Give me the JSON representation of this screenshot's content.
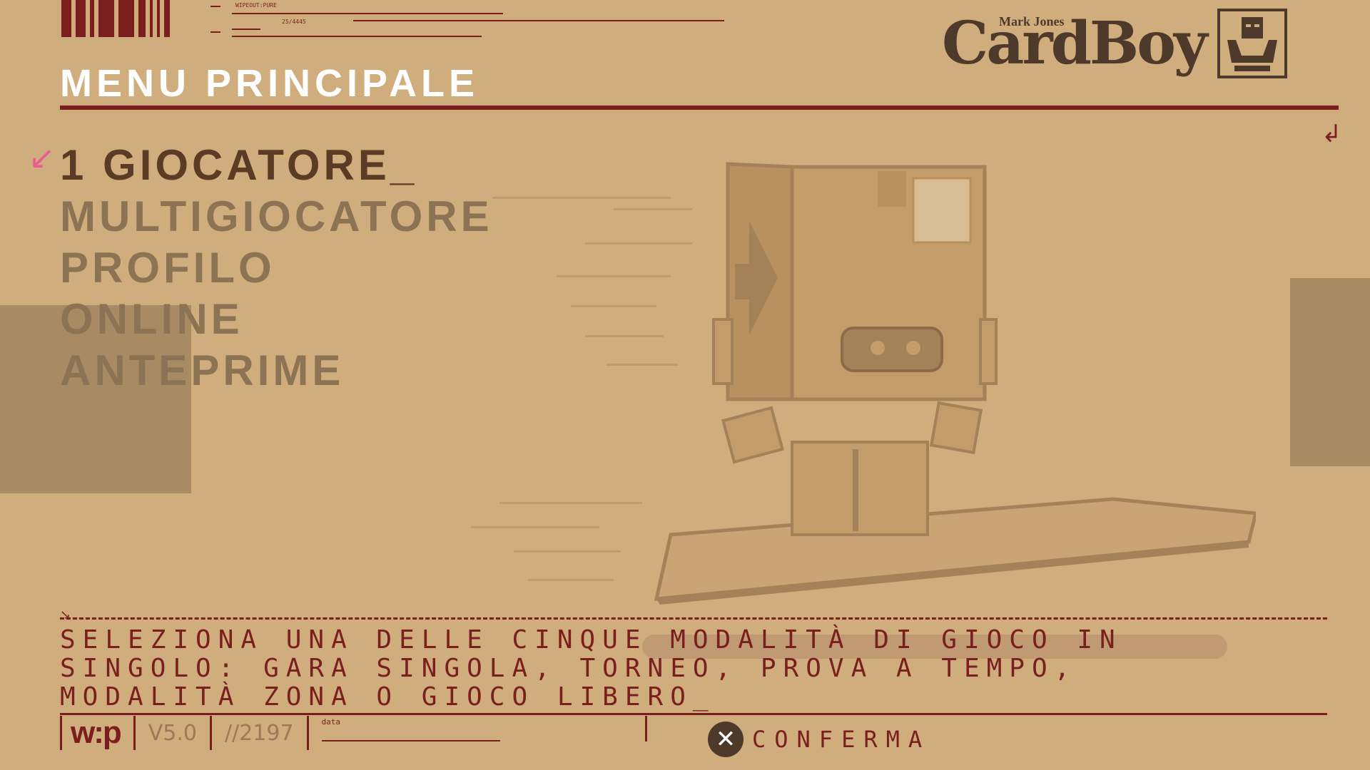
{
  "header": {
    "title": "MENU PRINCIPALE",
    "tiny_code_1": "WIPEOUT:PURE",
    "tiny_code_2": "25/4445"
  },
  "logo": {
    "brand": "CardBoy",
    "subtitle": "Mark Jones",
    "icon": "hands-box-icon"
  },
  "menu": {
    "selected_index": 0,
    "items": [
      {
        "label": "1 GIOCATORE_"
      },
      {
        "label": "MULTIGIOCATORE"
      },
      {
        "label": "PROFILO"
      },
      {
        "label": "ONLINE"
      },
      {
        "label": "ANTEPRIME"
      }
    ]
  },
  "description": {
    "text": "SELEZIONA UNA DELLE CINQUE MODALITÀ DI GIOCO IN SINGOLO: GARA SINGOLA, TORNEO, PROVA A TEMPO, MODALITÀ ZONA O GIOCO LIBERO_"
  },
  "footer": {
    "logo_text": "w:p",
    "version": "V5.0",
    "code": "//2197",
    "data_label": "data",
    "confirm_label": "CONFERMA",
    "confirm_icon": "cross-button-icon"
  },
  "colors": {
    "background": "#d0ad7d",
    "accent": "#7a1e1e",
    "title": "#ffffff",
    "selected": "#5a3c25",
    "unselected": "#8c7354",
    "cursor": "#e85c95"
  }
}
